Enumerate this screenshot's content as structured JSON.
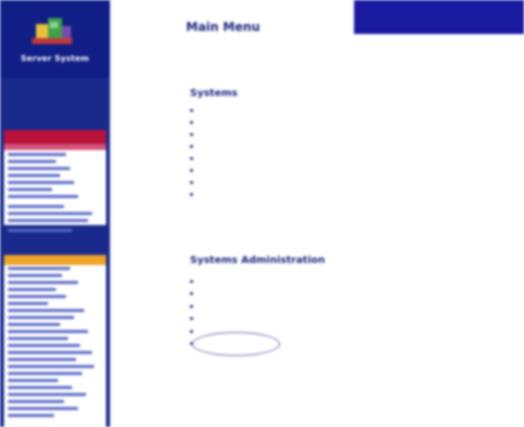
{
  "colors": {
    "sidebar_bg": "#1a2a8c",
    "section_red": "#b8123b",
    "section_orange": "#f0a52a",
    "header_blue": "#1a1aa0",
    "link": "#2a3aa8",
    "title": "#1a237e"
  },
  "sidebar": {
    "logo_icon": "building-blocks-logo-icon",
    "logo_title": "Server System",
    "caption": "",
    "panel1": {
      "header": "",
      "items": [
        "",
        "",
        "",
        "",
        "",
        "",
        "",
        "",
        "",
        "",
        ""
      ]
    },
    "panel2": {
      "header": "",
      "items": [
        "",
        "",
        "",
        "",
        "",
        "",
        "",
        "",
        "",
        "",
        "",
        "",
        "",
        "",
        "",
        "",
        "",
        "",
        "",
        "",
        "",
        ""
      ]
    }
  },
  "header": {
    "title": "Main Menu",
    "links": "",
    "links_count": 5
  },
  "main": {
    "section1": {
      "title": "Systems",
      "links": [
        "",
        "",
        "",
        "",
        "",
        "",
        "",
        ""
      ]
    },
    "section2": {
      "title": "Systems Administration",
      "links": [
        "",
        "",
        "",
        "",
        "",
        ""
      ]
    }
  }
}
